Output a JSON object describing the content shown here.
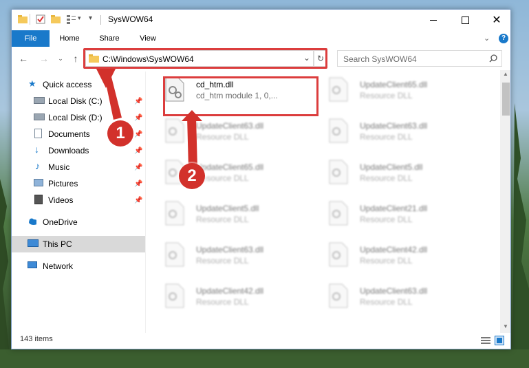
{
  "window": {
    "title": "SysWOW64"
  },
  "ribbon": {
    "tabs": [
      "File",
      "Home",
      "Share",
      "View"
    ]
  },
  "address": {
    "path": "C:\\Windows\\SysWOW64"
  },
  "search": {
    "placeholder": "Search SysWOW64"
  },
  "nav": {
    "items": [
      {
        "label": "Quick access"
      },
      {
        "label": "Local Disk (C:)"
      },
      {
        "label": "Local Disk (D:)"
      },
      {
        "label": "Documents"
      },
      {
        "label": "Downloads"
      },
      {
        "label": "Music"
      },
      {
        "label": "Pictures"
      },
      {
        "label": "Videos"
      },
      {
        "label": "OneDrive"
      },
      {
        "label": "This PC"
      },
      {
        "label": "Network"
      }
    ]
  },
  "files": [
    {
      "name": "cd_htm.dll",
      "desc": "cd_htm module 1, 0,..."
    },
    {
      "name": "UpdateClient65.dll",
      "desc": "Resource DLL"
    },
    {
      "name": "UpdateClient63.dll",
      "desc": "Resource DLL"
    },
    {
      "name": "UpdateClient63.dll",
      "desc": "Resource DLL"
    },
    {
      "name": "UpdateClient65.dll",
      "desc": "Resource DLL"
    },
    {
      "name": "UpdateClient5.dll",
      "desc": "Resource DLL"
    },
    {
      "name": "UpdateClient5.dll",
      "desc": "Resource DLL"
    },
    {
      "name": "UpdateClient21.dll",
      "desc": "Resource DLL"
    },
    {
      "name": "UpdateClient63.dll",
      "desc": "Resource DLL"
    },
    {
      "name": "UpdateClient42.dll",
      "desc": "Resource DLL"
    },
    {
      "name": "UpdateClient42.dll",
      "desc": "Resource DLL"
    },
    {
      "name": "UpdateClient63.dll",
      "desc": "Resource DLL"
    }
  ],
  "status": {
    "count": "143 items"
  },
  "annotations": {
    "step1": "1",
    "step2": "2"
  },
  "colors": {
    "highlight": "#dc3d3d",
    "accent": "#1979ca",
    "badge": "#d2312b"
  }
}
